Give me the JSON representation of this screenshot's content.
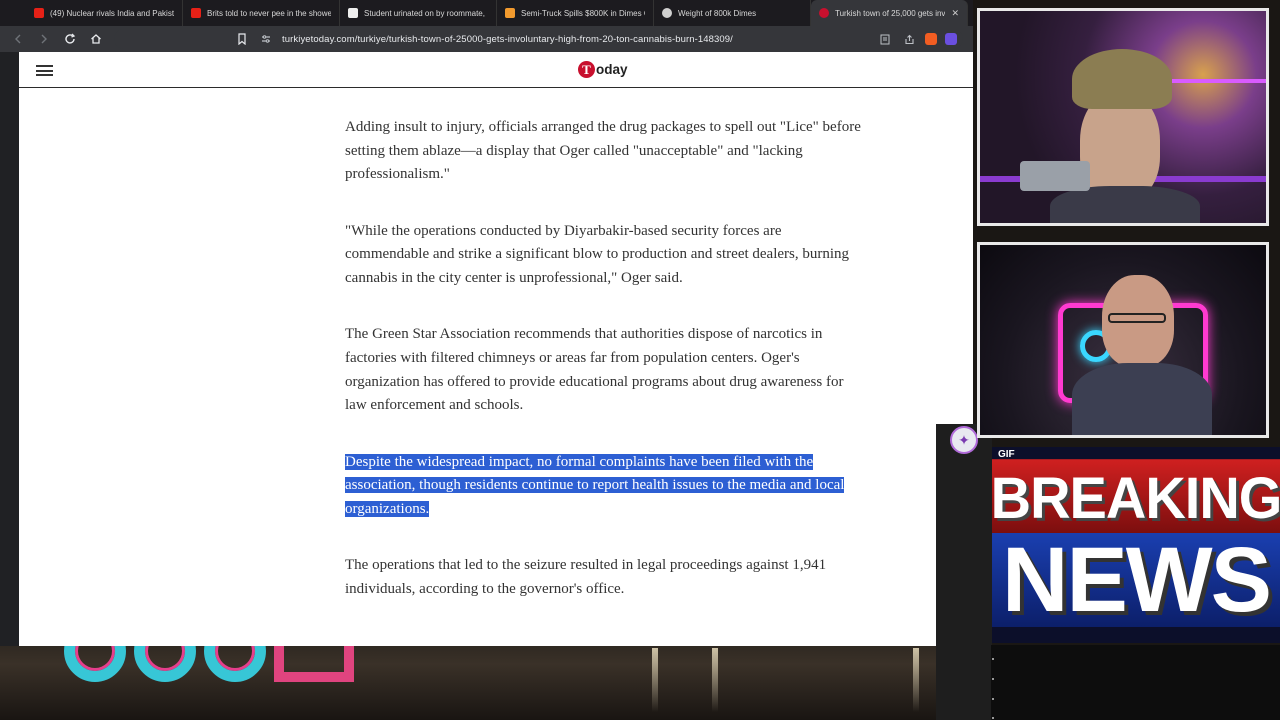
{
  "browser": {
    "tabs": [
      {
        "title": "(49) Nuclear rivals India and Pakista",
        "favicon_color": "#e62117"
      },
      {
        "title": "Brits told to never pee in the showe",
        "favicon_color": "#e62117"
      },
      {
        "title": "Student urinated on by roommate,",
        "favicon_color": "#eeeeee"
      },
      {
        "title": "Semi-Truck Spills $800K in Dimes C",
        "favicon_color": "#f29a2e"
      },
      {
        "title": "Weight of 800k Dimes",
        "favicon_color": "#d0d0d0"
      },
      {
        "title": "Turkish town of 25,000 gets inv",
        "favicon_color": "#c8102e",
        "active": true
      }
    ],
    "tab_close_glyph": "✕",
    "url": "turkiyetoday.com/turkiye/turkish-town-of-25000-gets-involuntary-high-from-20-ton-cannabis-burn-148309/"
  },
  "site": {
    "logo_mark": "T",
    "logo_word": "oday",
    "brand_color": "#c8102e"
  },
  "article": {
    "paragraphs": [
      "Adding insult to injury, officials arranged the drug packages to spell out \"Lice\" before setting them ablaze—a display that Oger called \"unacceptable\" and \"lacking professionalism.\"",
      "\"While the operations conducted by Diyarbakir-based security forces are commendable and strike a significant blow to production and street dealers, burning cannabis in the city center is unprofessional,\" Oger said.",
      "The Green Star Association recommends that authorities dispose of narcotics in factories with filtered chimneys or areas far from population centers. Oger's organization has offered to provide educational programs about drug awareness for law enforcement and schools.",
      "Despite the widespread impact, no formal complaints have been filed with the association, though residents continue to report health issues to the media and local organizations.",
      "The operations that led to the seizure resulted in legal proceedings against 1,941 individuals, according to the governor's office."
    ],
    "selected_paragraph_index": 3,
    "selection_color": "#2d5fd3"
  },
  "overlay": {
    "gif_label": "GIF",
    "breaking_text": "BREAKING",
    "news_text": "NEWS"
  },
  "icons": {
    "back": "back-arrow-icon",
    "forward": "forward-arrow-icon",
    "reload": "reload-icon",
    "home": "home-icon",
    "bookmark": "bookmark-icon",
    "menu": "hamburger-menu-icon"
  }
}
